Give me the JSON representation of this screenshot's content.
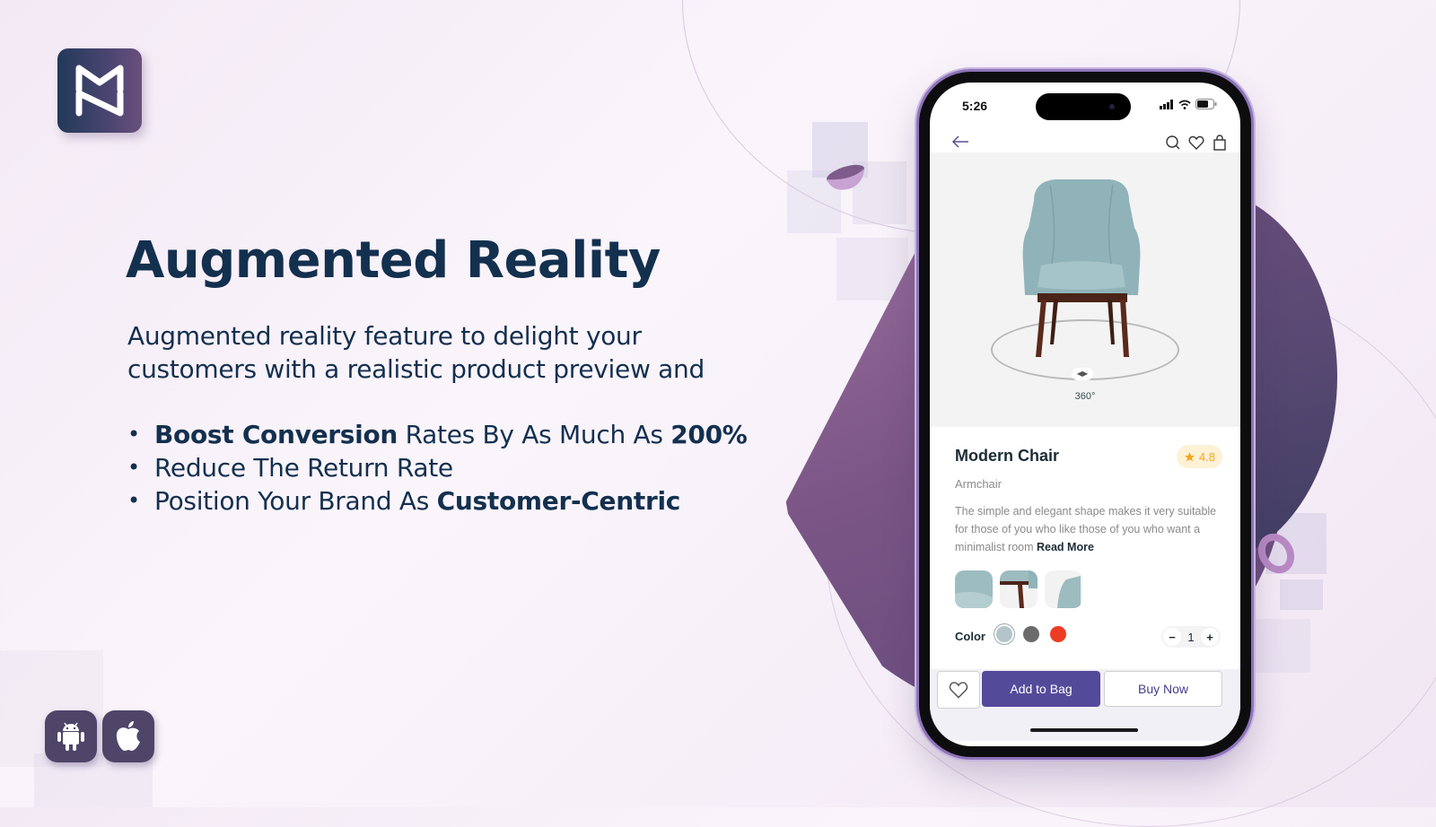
{
  "brand": {
    "logo_icon": "mn-monogram-icon"
  },
  "hero": {
    "title": "Augmented Reality",
    "intro": "Augmented reality feature to delight your customers with a realistic product preview and",
    "bullets": [
      {
        "bold_prefix": "Boost Conversion",
        "text": " Rates By As Much As ",
        "bold_suffix": "200%"
      },
      {
        "bold_prefix": "",
        "text": "Reduce The Return Rate",
        "bold_suffix": ""
      },
      {
        "bold_prefix": "",
        "text": "Position Your Brand As ",
        "bold_suffix": "Customer-Centric"
      }
    ]
  },
  "platforms": [
    {
      "name": "Android",
      "icon": "android-icon"
    },
    {
      "name": "iOS",
      "icon": "apple-icon"
    }
  ],
  "phone": {
    "status_bar": {
      "time": "5:26",
      "icons": [
        "signal-icon",
        "wifi-icon",
        "battery-icon"
      ]
    },
    "nav": {
      "back_icon": "arrow-left-icon",
      "actions": [
        "search-icon",
        "heart-icon",
        "bag-icon"
      ]
    },
    "viewer": {
      "rotation_label": "360°",
      "handle_icon": "rotate-arrows-icon"
    },
    "product": {
      "name": "Modern Chair",
      "rating": "4.8",
      "category": "Armchair",
      "description": "The simple and elegant shape makes it very suitable for those of you who like those of you who want a minimalist room",
      "read_more": "Read More",
      "thumbnails": [
        "chair-seat-closeup",
        "chair-leg-closeup",
        "chair-side-closeup"
      ],
      "color_label": "Color",
      "colors": [
        {
          "name": "light-blue",
          "hex": "#b4c4cb",
          "selected": true
        },
        {
          "name": "grey",
          "hex": "#6b6b6b",
          "selected": false
        },
        {
          "name": "red",
          "hex": "#ee3b23",
          "selected": false
        }
      ],
      "quantity": "1",
      "qty_minus": "−",
      "qty_plus": "+"
    },
    "actions": {
      "add_to_bag": "Add to Bag",
      "buy_now": "Buy Now"
    }
  },
  "colors": {
    "primary": "#534a9a",
    "heading": "#13304f",
    "accent_purple": "#6a4f7e",
    "rating": "#f3a81c"
  }
}
